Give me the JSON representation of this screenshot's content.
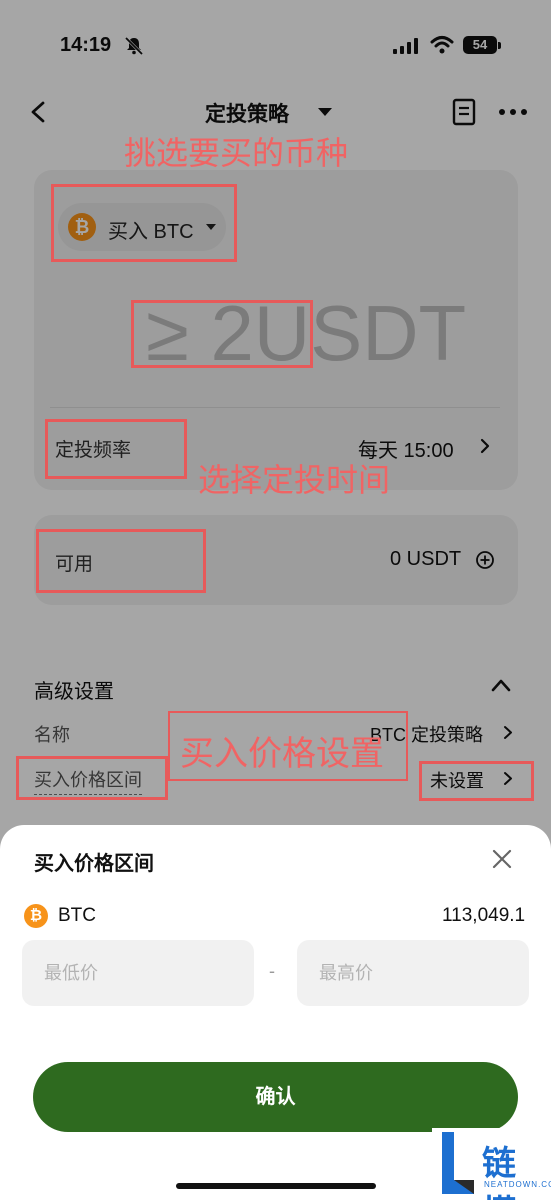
{
  "status_bar": {
    "time": "14:19",
    "battery": "54"
  },
  "nav": {
    "title": "定投策略"
  },
  "strategy_card": {
    "buy_label": "买入 BTC",
    "coin_icon": "bitcoin-icon",
    "amount_placeholder": "≥ 2USDT",
    "frequency_label": "定投频率",
    "frequency_value": "每天 15:00"
  },
  "available_card": {
    "label": "可用",
    "value": "0 USDT"
  },
  "advanced": {
    "title": "高级设置",
    "name_label": "名称",
    "name_value": "BTC 定投策略",
    "range_label": "买入价格区间",
    "range_value": "未设置"
  },
  "annotations": {
    "pick_coin": "挑选要买的币种",
    "pick_time": "选择定投时间",
    "buy_price": "买入价格设置",
    "color": "#e75a5a"
  },
  "sheet": {
    "title": "买入价格区间",
    "coin_label": "BTC",
    "coin_price": "113,049.1",
    "min_placeholder": "最低价",
    "max_placeholder": "最高价",
    "separator": "-",
    "confirm_label": "确认",
    "confirm_color": "#2e6a1f"
  },
  "watermark": {
    "cn": "链懂",
    "en": "NEATDOWN.COM"
  }
}
